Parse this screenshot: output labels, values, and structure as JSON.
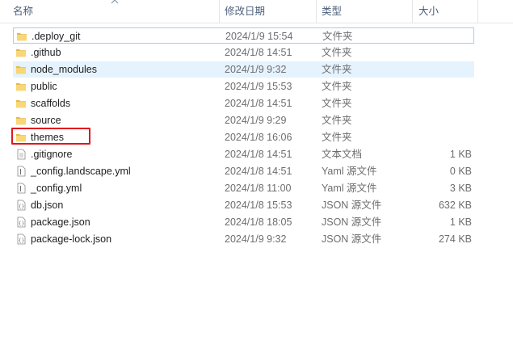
{
  "columns": {
    "name": "名称",
    "date": "修改日期",
    "type": "类型",
    "size": "大小"
  },
  "sort_indicator": "chevron-up-icon",
  "files": [
    {
      "name": ".deploy_git",
      "date": "2024/1/9 15:54",
      "type": "文件夹",
      "size": "",
      "icon": "folder-icon"
    },
    {
      "name": ".github",
      "date": "2024/1/8 14:51",
      "type": "文件夹",
      "size": "",
      "icon": "folder-icon"
    },
    {
      "name": "node_modules",
      "date": "2024/1/9 9:32",
      "type": "文件夹",
      "size": "",
      "icon": "folder-icon"
    },
    {
      "name": "public",
      "date": "2024/1/9 15:53",
      "type": "文件夹",
      "size": "",
      "icon": "folder-icon"
    },
    {
      "name": "scaffolds",
      "date": "2024/1/8 14:51",
      "type": "文件夹",
      "size": "",
      "icon": "folder-icon"
    },
    {
      "name": "source",
      "date": "2024/1/9 9:29",
      "type": "文件夹",
      "size": "",
      "icon": "folder-icon"
    },
    {
      "name": "themes",
      "date": "2024/1/8 16:06",
      "type": "文件夹",
      "size": "",
      "icon": "folder-icon"
    },
    {
      "name": ".gitignore",
      "date": "2024/1/8 14:51",
      "type": "文本文档",
      "size": "1 KB",
      "icon": "text-file-icon"
    },
    {
      "name": "_config.landscape.yml",
      "date": "2024/1/8 14:51",
      "type": "Yaml 源文件",
      "size": "0 KB",
      "icon": "yaml-file-icon"
    },
    {
      "name": "_config.yml",
      "date": "2024/1/8 11:00",
      "type": "Yaml 源文件",
      "size": "3 KB",
      "icon": "yaml-file-icon"
    },
    {
      "name": "db.json",
      "date": "2024/1/8 15:53",
      "type": "JSON 源文件",
      "size": "632 KB",
      "icon": "json-file-icon"
    },
    {
      "name": "package.json",
      "date": "2024/1/8 18:05",
      "type": "JSON 源文件",
      "size": "1 KB",
      "icon": "json-file-icon"
    },
    {
      "name": "package-lock.json",
      "date": "2024/1/9 9:32",
      "type": "JSON 源文件",
      "size": "274 KB",
      "icon": "json-file-icon"
    }
  ],
  "colors": {
    "folder": "#f8d775",
    "folder_dark": "#e8b84a",
    "focus_border": "#99d1ff",
    "hover_bg": "#e5f3ff",
    "annotation_red": "#e0161e"
  }
}
